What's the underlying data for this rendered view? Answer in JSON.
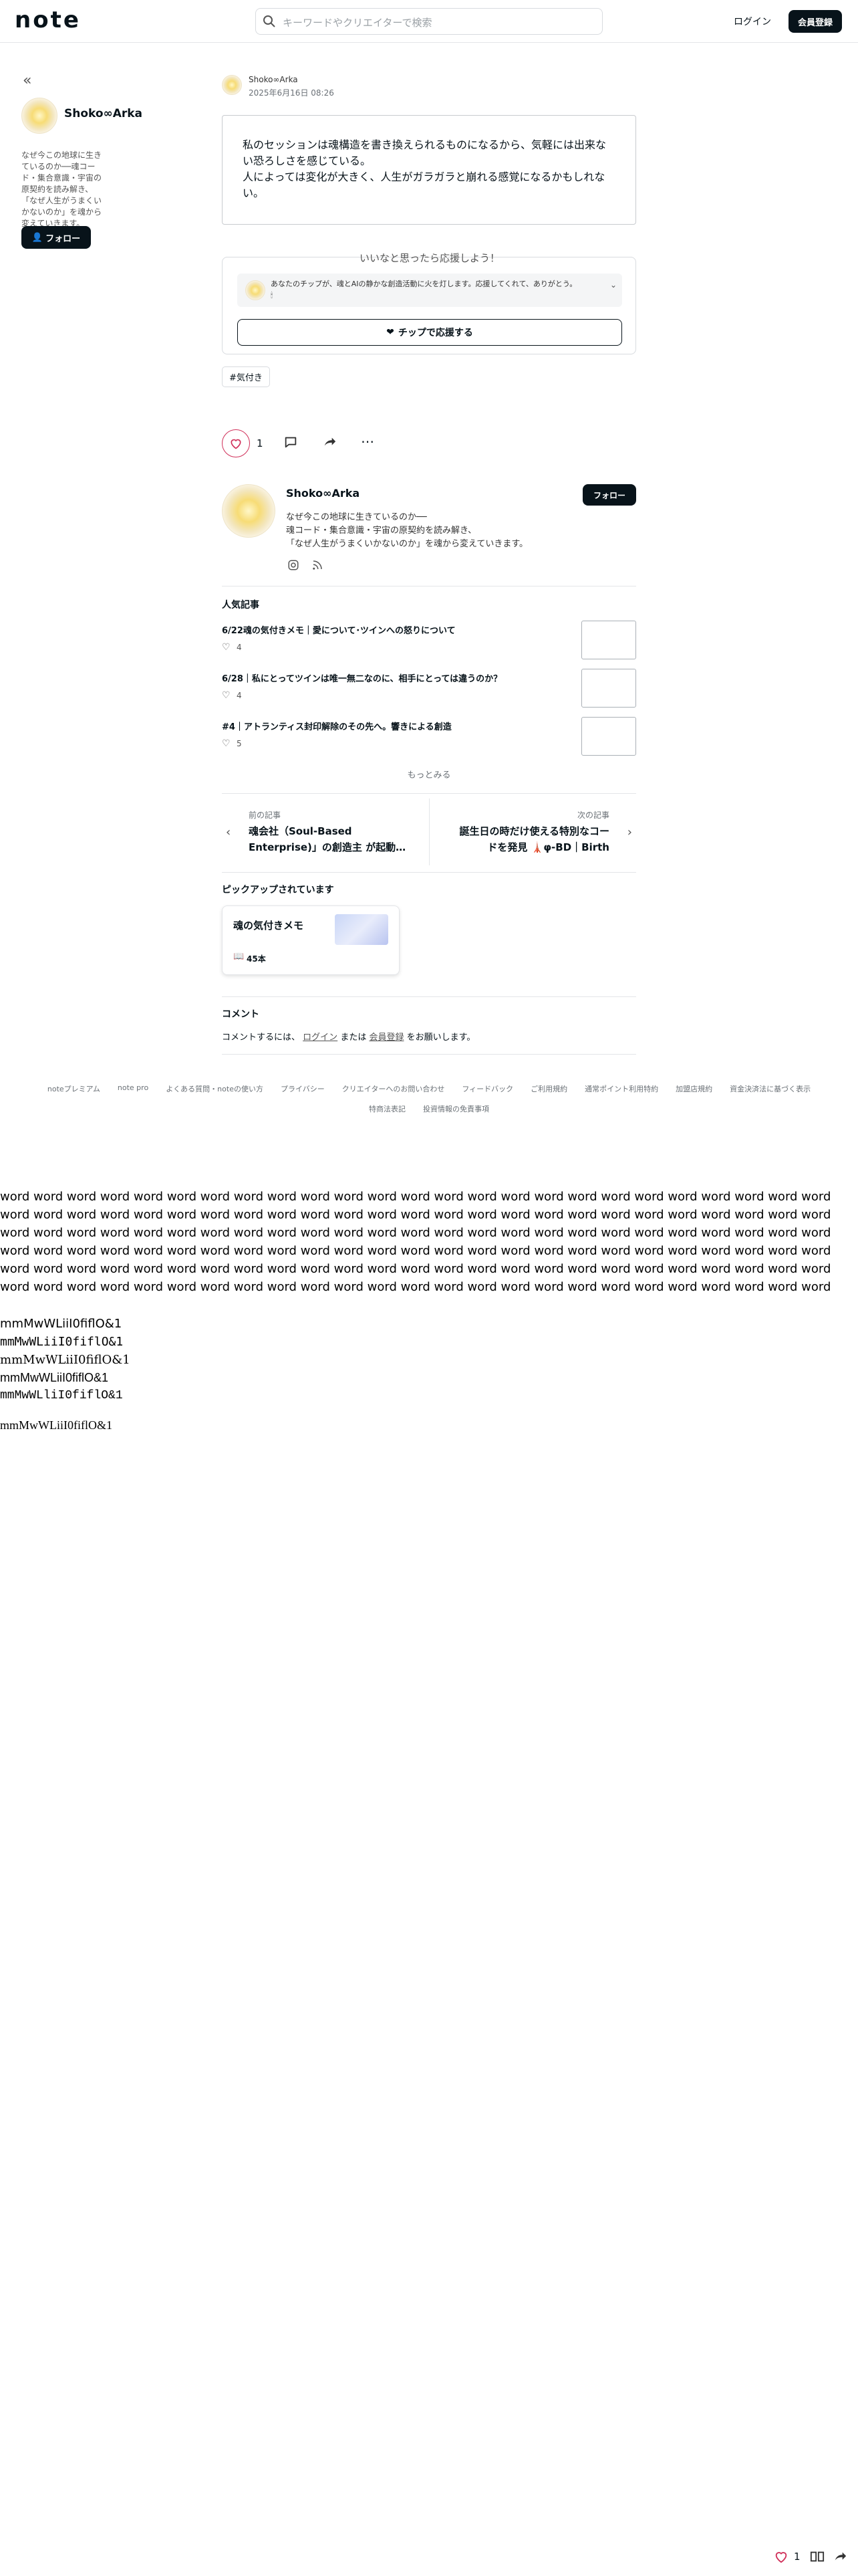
{
  "header": {
    "logo": "note",
    "search_placeholder": "キーワードやクリエイターで検索",
    "login": "ログイン",
    "signup": "会員登録"
  },
  "sidebar": {
    "collapse_icon": "double-chevron-left-icon",
    "creator_name": "Shoko∞Arka",
    "bio": "なぜ今この地球に生きているのか──魂コード・集合意識・宇宙の原契約を読み解き、「なぜ人生がうまくいかないのか」を魂から変えていきます。",
    "follow": "フォロー"
  },
  "article": {
    "author": "Shoko∞Arka",
    "date": "2025年6月16日 08:26",
    "quote_line1": "私のセッションは魂構造を書き換えられるものになるから、気軽には出来ない恐ろしさを感じている。",
    "quote_line2": "人によっては変化が大きく、人生がガラガラと崩れる感覚になるかもしれない。",
    "support_title": "いいなと思ったら応援しよう！",
    "support_message": "あなたのチップが、魂とAIの静かな創造活動に火を灯します。応援してくれて、ありがとう。",
    "support_message_tail": "🕯",
    "tip_button": "チップで応援する",
    "tag": "#気付き",
    "like_count": "1"
  },
  "creator_card": {
    "name": "Shoko∞Arka",
    "follow": "フォロー",
    "bio_line1": "なぜ今この地球に生きているのか──",
    "bio_line2": "魂コード・集合意識・宇宙の原契約を読み解き、",
    "bio_line3": "「なぜ人生がうまくいかないのか」を魂から変えていきます。"
  },
  "popular": {
    "title": "人気記事",
    "items": [
      {
        "title": "6/22魂の気付きメモ｜愛について･ツインへの怒りについて",
        "likes": "4"
      },
      {
        "title": "6/28｜私にとってツインは唯一無二なのに、相手にとっては違うのか？",
        "likes": "4"
      },
      {
        "title": "#4｜アトランティス封印解除のその先へ。響きによる創造",
        "likes": "5"
      }
    ],
    "more": "もっとみる"
  },
  "nav": {
    "prev_label": "前の記事",
    "prev_title_line1": "魂会社（Soul-Based",
    "prev_title_line2": "Enterprise)」の創造主 が起動…",
    "next_label": "次の記事",
    "next_title_line1": "誕生日の時だけ使える特別なコー",
    "next_title_line2": "ドを発見 🗼φ-BD｜Birth"
  },
  "pickup": {
    "title": "ピックアップされています",
    "card_title": "魂の気付きメモ",
    "card_count": "45本"
  },
  "comments": {
    "title": "コメント",
    "prefix": "コメントするには、",
    "login": "ログイン",
    "or": "または",
    "signup": "会員登録",
    "suffix": "をお願いします。"
  },
  "footer": {
    "links_row1": [
      "noteプレミアム",
      "note pro",
      "よくある質問・noteの使い方",
      "プライバシー",
      "クリエイターへのお問い合わせ",
      "フィードバック",
      "ご利用規約",
      "通常ポイント利用特約",
      "加盟店規約",
      "資金決済法に基づく表示"
    ],
    "links_row2": [
      "特商法表記",
      "投資情報の免責事項"
    ]
  },
  "font_probe": {
    "word_text": "word word word word word word word word word word word word word word word word word word word word word word word word word word word word word word word word word word word word word word word word word word word word word word word word word word word word word word word word word word word word word word word word word word word word word word word word word word word word word word word word word word word word word word word word word word word word word word word word word word word word word word word word word word word word word word word word word word word word word word word word word word word word word word word word word word word word word word word word word word word word word word word word word word word word word word word word word word word word word word word word word word word word word word word word word word word word word word word word word word word word word word word word word word word word word word word word word word word word word word word word word word word word word word word word word word word word word word word word word word word word word word word word word word word word word word word word word word word word word word word word word word",
    "samples": [
      "mmMwWLiiI0fiflO&1",
      "mmMwWLiiI0fiflO&1",
      "mmMwWLiiI0fiflO&1",
      "mmMwWLiiI0fiflO&1",
      "mmMwWLliI0fiflO&1",
      "mmMwWLiiI0fiflO&1"
    ]
  },
  "bottom_bar": {
    "like_count": "1"
  }
}
